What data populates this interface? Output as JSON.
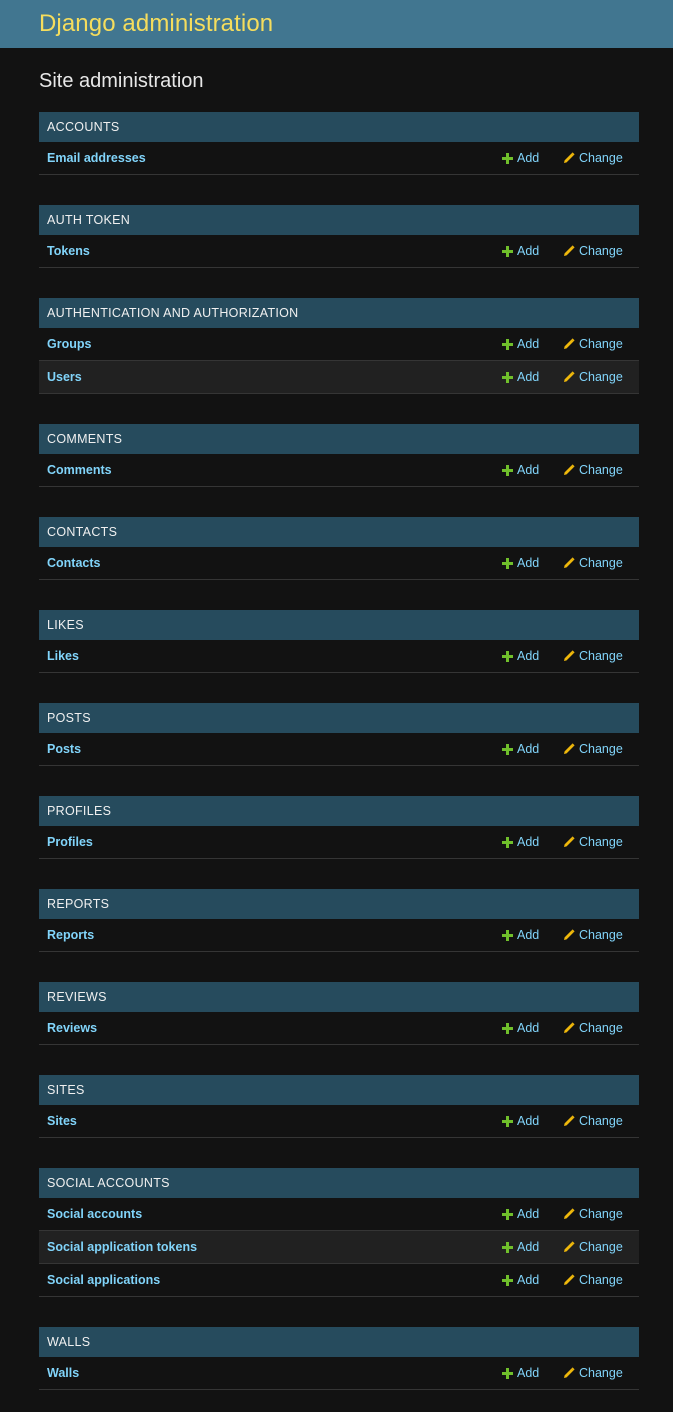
{
  "header": {
    "branding": "Django administration"
  },
  "page": {
    "title": "Site administration"
  },
  "colors": {
    "header_bg": "#417690",
    "branding": "#f5dd5d",
    "caption_bg": "#264b5d",
    "link": "#81d4fa",
    "add_icon": "#70bf2b",
    "change_icon": "#efb80b"
  },
  "actions": {
    "add_label": "Add",
    "change_label": "Change",
    "add_icon": "plus-icon",
    "change_icon": "pencil-icon"
  },
  "modules": [
    {
      "caption": "ACCOUNTS",
      "models": [
        "Email addresses"
      ]
    },
    {
      "caption": "AUTH TOKEN",
      "models": [
        "Tokens"
      ]
    },
    {
      "caption": "AUTHENTICATION AND AUTHORIZATION",
      "models": [
        "Groups",
        "Users"
      ]
    },
    {
      "caption": "COMMENTS",
      "models": [
        "Comments"
      ]
    },
    {
      "caption": "CONTACTS",
      "models": [
        "Contacts"
      ]
    },
    {
      "caption": "LIKES",
      "models": [
        "Likes"
      ]
    },
    {
      "caption": "POSTS",
      "models": [
        "Posts"
      ]
    },
    {
      "caption": "PROFILES",
      "models": [
        "Profiles"
      ]
    },
    {
      "caption": "REPORTS",
      "models": [
        "Reports"
      ]
    },
    {
      "caption": "REVIEWS",
      "models": [
        "Reviews"
      ]
    },
    {
      "caption": "SITES",
      "models": [
        "Sites"
      ]
    },
    {
      "caption": "SOCIAL ACCOUNTS",
      "models": [
        "Social accounts",
        "Social application tokens",
        "Social applications"
      ]
    },
    {
      "caption": "WALLS",
      "models": [
        "Walls"
      ]
    }
  ]
}
